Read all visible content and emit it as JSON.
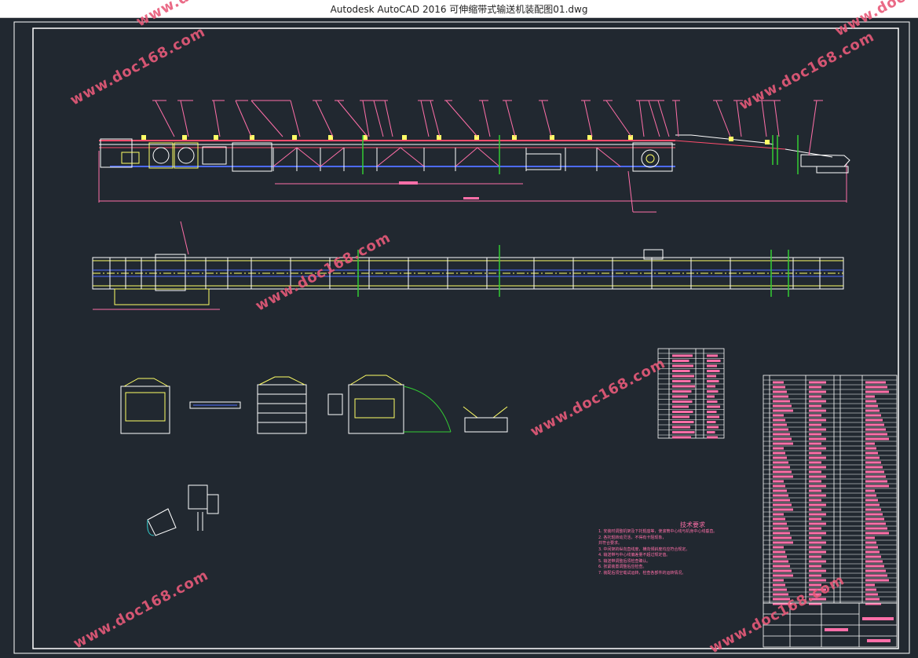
{
  "window": {
    "title": "Autodesk AutoCAD 2016    可伸缩带式输送机装配图01.dwg"
  },
  "watermark": {
    "text": "www.doc168.com",
    "color": "#e85a7a"
  },
  "drawing": {
    "background": "#212830",
    "border_color": "#ffffff",
    "line_colors": {
      "frame": "#ffffff",
      "belt": "#ff4d6d",
      "idler": "#ffff66",
      "leader": "#ff6fa8",
      "axis": "#4d6bff",
      "dimension": "#ff6fa8",
      "guard": "#33cc33"
    },
    "tech_notes": {
      "title": "技术要求",
      "lines": [
        "1. 安装时调整机架及下托辊座等，使滚筒中心线与机身中心线垂直。",
        "2. 各托辊转动灵活，不得有卡阻现象，",
        "   并符合要求。",
        "3. 中间架的纵向直线度，横向倾斜度均应符合规定。",
        "4. 输送带与中心线偏差量不超过规定值。",
        "5. 输送带调整后须检查确认。",
        "6. 张紧装置调整后应检查。",
        "7. 装配后须空载试运转，检查各部件的运转情况。"
      ]
    },
    "title_block": {
      "label": "装配图"
    }
  }
}
